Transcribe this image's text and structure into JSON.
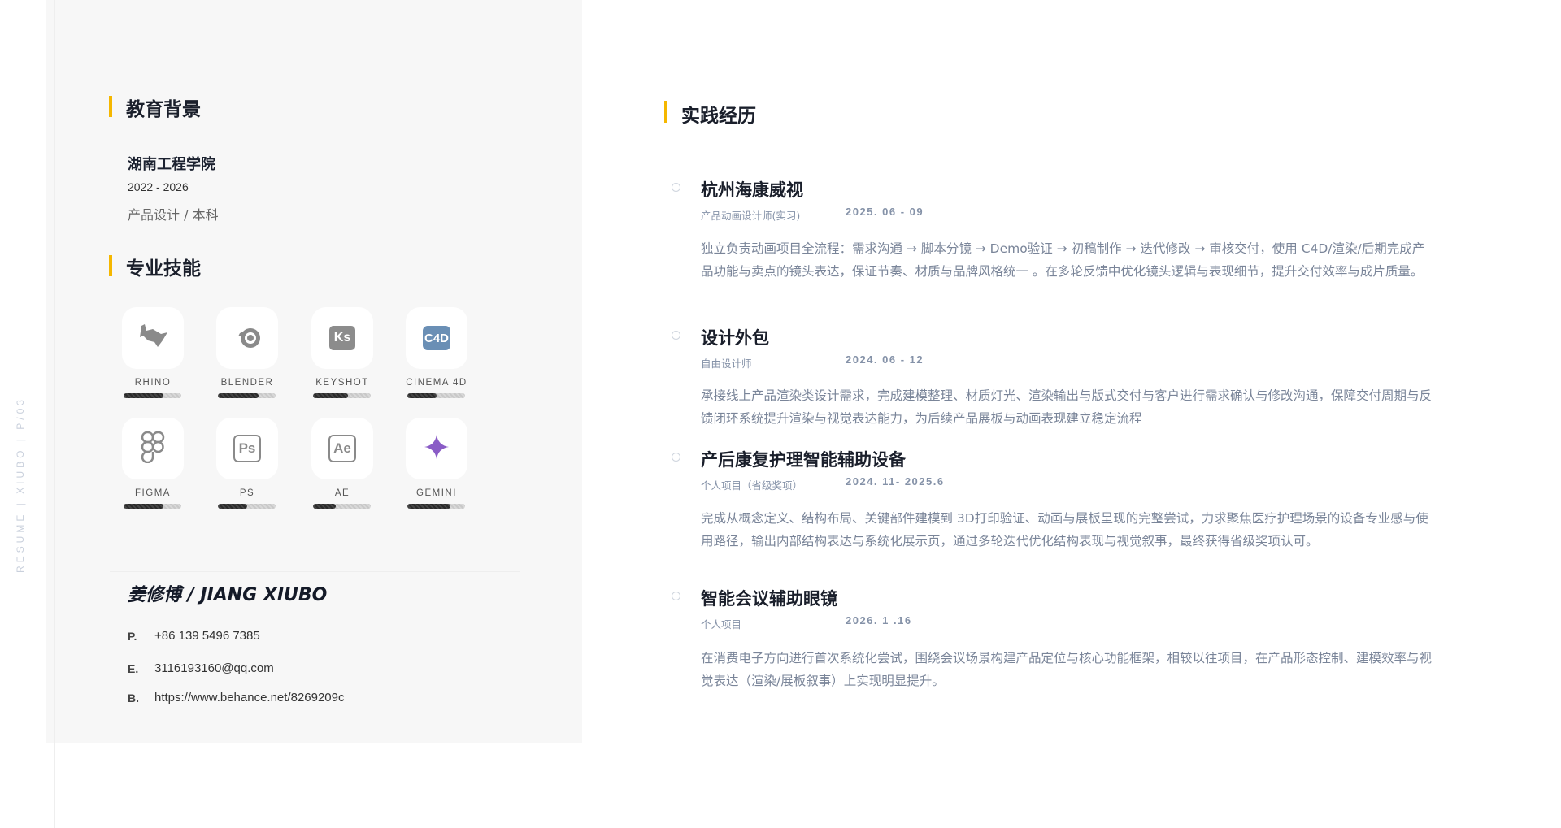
{
  "side_label": "RESUME | XIUBO | P/03",
  "education": {
    "heading": "教育背景",
    "school": "湖南工程学院",
    "years": "2022 - 2026",
    "major": "产品设计 / 本科"
  },
  "skills": {
    "heading": "专业技能",
    "items": [
      {
        "name": "RHINO",
        "icon": "rhino-icon",
        "level": 0.69
      },
      {
        "name": "BLENDER",
        "icon": "blender-icon",
        "level": 0.7
      },
      {
        "name": "KEYSHOT",
        "icon": "keyshot-icon",
        "level": 0.6
      },
      {
        "name": "CINEMA 4D",
        "icon": "cinema4d-icon",
        "level": 0.5
      },
      {
        "name": "FIGMA",
        "icon": "figma-icon",
        "level": 0.69
      },
      {
        "name": "PS",
        "icon": "photoshop-icon",
        "level": 0.5
      },
      {
        "name": "AE",
        "icon": "after-effects-icon",
        "level": 0.4
      },
      {
        "name": "GEMINI",
        "icon": "gemini-icon",
        "level": 0.75
      }
    ]
  },
  "contact": {
    "name": "姜修博 / JIANG XIUBO",
    "items": [
      {
        "label": "P.",
        "value": "+86 139 5496 7385"
      },
      {
        "label": "E.",
        "value": "3116193160@qq.com"
      },
      {
        "label": "B.",
        "value": "https://www.behance.net/8269209c"
      }
    ]
  },
  "experience": {
    "heading": "实践经历",
    "items": [
      {
        "title": "杭州海康威视",
        "role": "产品动画设计师(实习)",
        "date": "2025. 06 - 09",
        "desc": "独立负责动画项目全流程：需求沟通 → 脚本分镜 → Demo验证 → 初稿制作 → 迭代修改 → 审核交付，使用 C4D/渲染/后期完成产品功能与卖点的镜头表达，保证节奏、材质与品牌风格统一 。在多轮反馈中优化镜头逻辑与表现细节，提升交付效率与成片质量。"
      },
      {
        "title": "设计外包",
        "role": "自由设计师",
        "date": "2024. 06 - 12",
        "desc": "承接线上产品渲染类设计需求，完成建模整理、材质灯光、渲染输出与版式交付与客户进行需求确认与修改沟通，保障交付周期与反馈闭环系统提升渲染与视觉表达能力，为后续产品展板与动画表现建立稳定流程"
      },
      {
        "title": "产后康复护理智能辅助设备",
        "role": "个人项目（省级奖项）",
        "date": "2024. 11- 2025.6",
        "desc": "完成从概念定义、结构布局、关键部件建模到 3D打印验证、动画与展板呈现的完整尝试，力求聚焦医疗护理场景的设备专业感与使用路径，输出内部结构表达与系统化展示页，通过多轮迭代优化结构表现与视觉叙事，最终获得省级奖项认可。"
      },
      {
        "title": "智能会议辅助眼镜",
        "role": "个人项目",
        "date": "2026. 1 .16",
        "desc": "在消费电子方向进行首次系统化尝试，围绕会议场景构建产品定位与核心功能框架，相较以往项目，在产品形态控制、建模效率与视觉表达（渲染/展板叙事）上实现明显提升。"
      }
    ]
  },
  "colors": {
    "accent": "#f5b700",
    "c4d": "#6a8fb5",
    "gemini": "#8a5cc6",
    "panel": "#f7f7f7"
  }
}
